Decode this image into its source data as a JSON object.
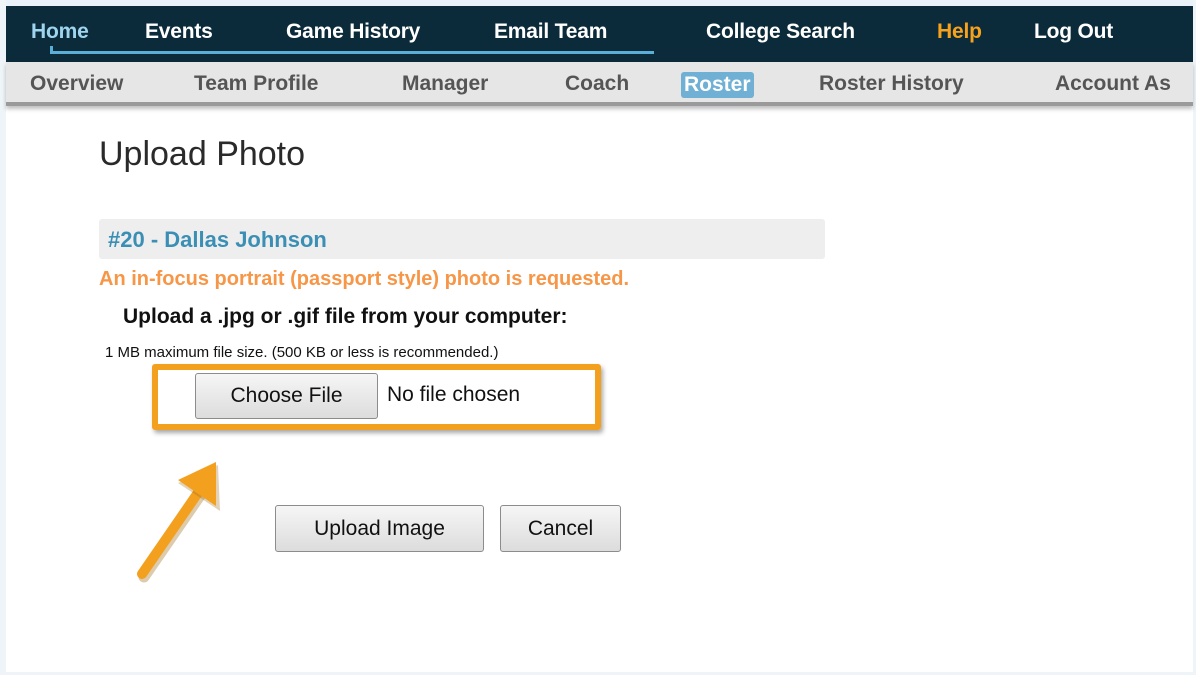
{
  "top_nav": {
    "items": [
      {
        "label": "Home",
        "active": true
      },
      {
        "label": "Events"
      },
      {
        "label": "Game History"
      },
      {
        "label": "Email Team"
      },
      {
        "label": "College Search"
      },
      {
        "label": "Help",
        "highlight": true
      },
      {
        "label": "Log Out"
      }
    ]
  },
  "sub_nav": {
    "items": [
      {
        "label": "Overview"
      },
      {
        "label": "Team Profile"
      },
      {
        "label": "Manager"
      },
      {
        "label": "Coach"
      },
      {
        "label": "Roster",
        "current": true
      },
      {
        "label": "Roster History"
      },
      {
        "label": "Account As"
      }
    ]
  },
  "page": {
    "title": "Upload Photo",
    "player": "#20 - Dallas Johnson",
    "notice": "An in-focus portrait (passport style) photo is requested.",
    "instruction": "Upload a .jpg or .gif file from your computer:",
    "size_note": "1 MB maximum file size. (500 KB or less is recommended.)"
  },
  "file_input": {
    "button_label": "Choose File",
    "status": "No file chosen"
  },
  "actions": {
    "upload_label": "Upload Image",
    "cancel_label": "Cancel"
  },
  "colors": {
    "top_nav_bg": "#0c2b3a",
    "active_nav": "#9fd4ee",
    "help": "#f7a21b",
    "player_name": "#3b8fb5",
    "notice": "#f79646",
    "highlight": "#f4a01f"
  },
  "icons": {
    "pointer": "arrow-icon"
  }
}
